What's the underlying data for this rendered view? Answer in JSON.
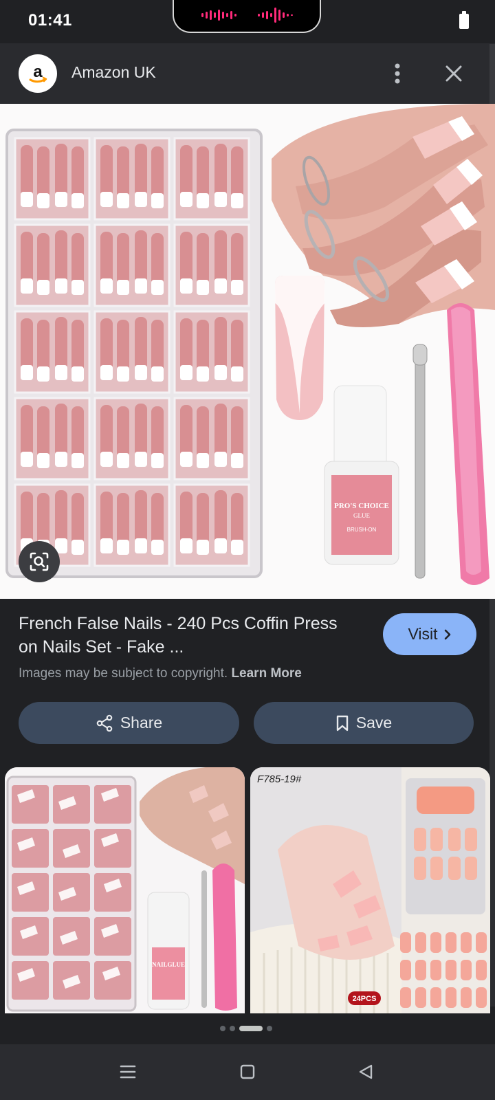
{
  "status_bar": {
    "time": "01:41",
    "battery_icon": "battery-icon"
  },
  "header": {
    "source_name": "Amazon UK",
    "logo_letter": "a",
    "logo_icon": "amazon-logo-icon",
    "menu_icon": "more-vert-icon",
    "close_icon": "close-icon"
  },
  "main_image": {
    "glue_label_line1": "PRO'S CHOICE",
    "glue_label_line2": "GLUE",
    "glue_label_line3": "BRUSH-ON"
  },
  "result": {
    "title": "French False Nails - 240 Pcs Coffin Press on Nails Set - Fake ...",
    "visit_label": "Visit",
    "copyright_text": "Images may be subject to copyright.",
    "learn_more": "Learn More"
  },
  "actions": {
    "share_label": "Share",
    "save_label": "Save"
  },
  "related": [
    {
      "glue_label": "NAILGLUE"
    },
    {
      "code_label": "F785-19#",
      "badge": "24PCS"
    }
  ],
  "carousel": {
    "active_index": 2,
    "count": 4
  },
  "nav_bar": {
    "items": [
      "menu-icon",
      "home-icon",
      "back-icon"
    ]
  },
  "colors": {
    "accent": "#8ab4f8",
    "action_button": "#3c4a5e",
    "background": "#202124"
  }
}
